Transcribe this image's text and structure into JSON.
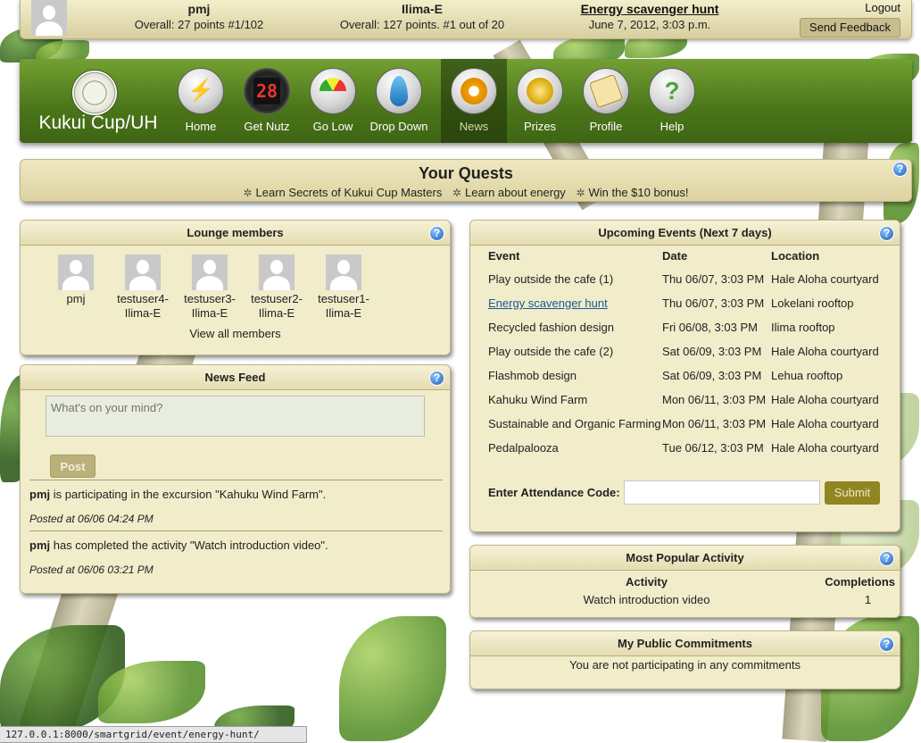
{
  "topbar": {
    "user_name": "pmj",
    "user_overall": "Overall: 27 points #1/102",
    "team_name": "Ilima-E",
    "team_overall": "Overall: 127 points. #1 out of 20",
    "event_title": "Energy scavenger hunt",
    "event_datetime": "June 7, 2012, 3:03 p.m.",
    "logout": "Logout",
    "send_feedback": "Send Feedback"
  },
  "nav": {
    "brand": "Kukui Cup/UH",
    "items": [
      {
        "label": "Home",
        "icon": "lightning-icon"
      },
      {
        "label": "Get Nutz",
        "icon": "scoreboard-icon",
        "display": "28"
      },
      {
        "label": "Go Low",
        "icon": "gauge-icon"
      },
      {
        "label": "Drop Down",
        "icon": "water-drop-icon"
      },
      {
        "label": "News",
        "icon": "megaphone-icon"
      },
      {
        "label": "Prizes",
        "icon": "medal-icon"
      },
      {
        "label": "Profile",
        "icon": "id-tag-icon"
      },
      {
        "label": "Help",
        "icon": "question-icon"
      }
    ],
    "active": "News"
  },
  "quests": {
    "title": "Your Quests",
    "items": [
      "Learn Secrets of Kukui Cup Masters",
      "Learn about energy",
      "Win the $10 bonus!"
    ]
  },
  "lounge": {
    "title": "Lounge members",
    "members": [
      {
        "line1": "pmj",
        "line2": ""
      },
      {
        "line1": "testuser4-",
        "line2": "Ilima-E"
      },
      {
        "line1": "testuser3-",
        "line2": "Ilima-E"
      },
      {
        "line1": "testuser2-",
        "line2": "Ilima-E"
      },
      {
        "line1": "testuser1-",
        "line2": "Ilima-E"
      }
    ],
    "view_all": "View all members"
  },
  "news": {
    "title": "News Feed",
    "placeholder": "What's on your mind?",
    "post": "Post",
    "items": [
      {
        "user": "pmj",
        "text": " is participating in the excursion \"Kahuku Wind Farm\".",
        "when": "Posted at 06/06 04:24 PM"
      },
      {
        "user": "pmj",
        "text": " has completed the activity \"Watch introduction video\".",
        "when": "Posted at 06/06 03:21 PM"
      }
    ]
  },
  "events": {
    "title": "Upcoming Events (Next 7 days)",
    "headers": [
      "Event",
      "Date",
      "Location"
    ],
    "rows": [
      {
        "event": "Play outside the cafe (1)",
        "date": "Thu 06/07, 3:03 PM",
        "location": "Hale Aloha courtyard",
        "link": false
      },
      {
        "event": "Energy scavenger hunt",
        "date": "Thu 06/07, 3:03 PM",
        "location": "Lokelani rooftop",
        "link": true
      },
      {
        "event": "Recycled fashion design",
        "date": "Fri 06/08, 3:03 PM",
        "location": "Ilima rooftop",
        "link": false
      },
      {
        "event": "Play outside the cafe (2)",
        "date": "Sat 06/09, 3:03 PM",
        "location": "Hale Aloha courtyard",
        "link": false
      },
      {
        "event": "Flashmob design",
        "date": "Sat 06/09, 3:03 PM",
        "location": "Lehua rooftop",
        "link": false
      },
      {
        "event": "Kahuku Wind Farm",
        "date": "Mon 06/11, 3:03 PM",
        "location": "Hale Aloha courtyard",
        "link": false
      },
      {
        "event": "Sustainable and Organic Farming",
        "date": "Mon 06/11, 3:03 PM",
        "location": "Hale Aloha courtyard",
        "link": false
      },
      {
        "event": "Pedalpalooza",
        "date": "Tue 06/12, 3:03 PM",
        "location": "Hale Aloha courtyard",
        "link": false
      }
    ],
    "attendance_label": "Enter Attendance Code:",
    "attendance_value": "",
    "submit": "Submit"
  },
  "popular": {
    "title": "Most Popular Activity",
    "headers": [
      "Activity",
      "Completions"
    ],
    "rows": [
      {
        "activity": "Watch introduction video",
        "completions": "1"
      }
    ]
  },
  "commitments": {
    "title": "My Public Commitments",
    "message": "You are not participating in any commitments"
  },
  "help_glyph": "?",
  "statusbar": "127.0.0.1:8000/smartgrid/event/energy-hunt/",
  "colors": {
    "nav_green": "#4b7519",
    "panel_bg": "#f1ecca",
    "link_blue": "#1a5a96",
    "submit_olive": "#8f8523"
  }
}
